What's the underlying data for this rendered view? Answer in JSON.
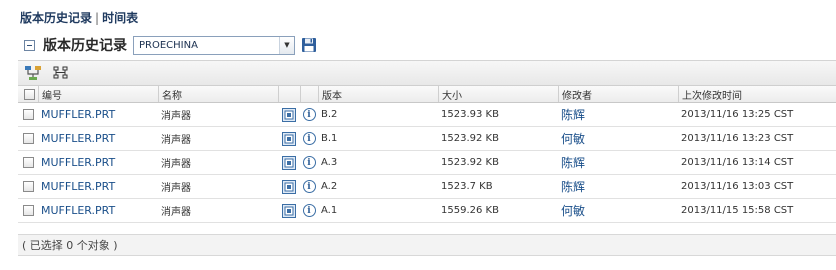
{
  "breadcrumb": {
    "history": "版本历史记录",
    "separator": "|",
    "timeline": "时间表"
  },
  "panel": {
    "title": "版本历史记录",
    "context_value": "PROECHINA"
  },
  "columns": {
    "number": "编号",
    "name": "名称",
    "version": "版本",
    "size": "大小",
    "modifier": "修改者",
    "last_modified": "上次修改时间"
  },
  "rows": [
    {
      "number": "MUFFLER.PRT",
      "name": "消声器",
      "version": "B.2",
      "size": "1523.93 KB",
      "modifier": "陈辉",
      "last_modified": "2013/11/16 13:25 CST"
    },
    {
      "number": "MUFFLER.PRT",
      "name": "消声器",
      "version": "B.1",
      "size": "1523.92 KB",
      "modifier": "何敏",
      "last_modified": "2013/11/16 13:23 CST"
    },
    {
      "number": "MUFFLER.PRT",
      "name": "消声器",
      "version": "A.3",
      "size": "1523.92 KB",
      "modifier": "陈辉",
      "last_modified": "2013/11/16 13:14 CST"
    },
    {
      "number": "MUFFLER.PRT",
      "name": "消声器",
      "version": "A.2",
      "size": "1523.7 KB",
      "modifier": "陈辉",
      "last_modified": "2013/11/16 13:03 CST"
    },
    {
      "number": "MUFFLER.PRT",
      "name": "消声器",
      "version": "A.1",
      "size": "1559.26 KB",
      "modifier": "何敏",
      "last_modified": "2013/11/15 15:58 CST"
    }
  ],
  "info_glyph": "i",
  "status": "( 已选择 0 个对象 )",
  "icons": {
    "collapse": "collapse-icon",
    "dropdown": "chevron-down-icon",
    "save": "save-icon",
    "compare": "compare-icon",
    "tree": "tree-icon",
    "view": "view-icon",
    "info": "info-icon"
  },
  "colors": {
    "link": "#1a4f8a",
    "title": "#1f3a5f"
  }
}
